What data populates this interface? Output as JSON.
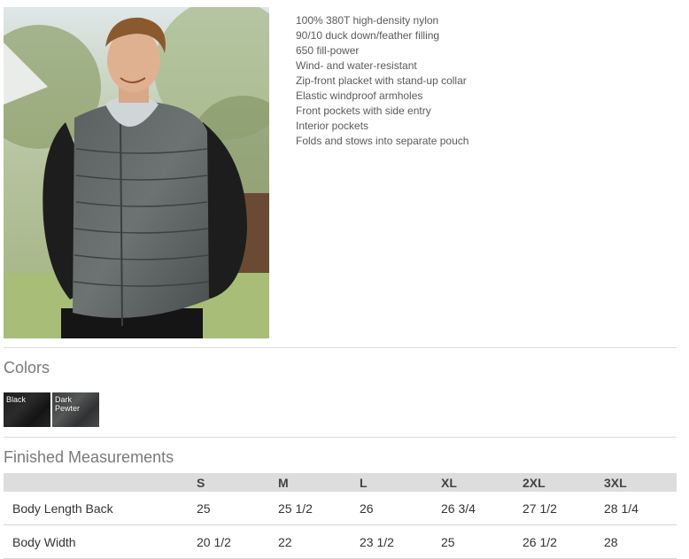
{
  "features": [
    "100% 380T high-density nylon",
    "90/10 duck down/feather filling",
    "650 fill-power",
    "Wind- and water-resistant",
    "Zip-front placket with stand-up collar",
    "Elastic windproof armholes",
    "Front pockets with side entry",
    "Interior pockets",
    "Folds and stows into separate pouch"
  ],
  "colors_section": {
    "title": "Colors",
    "swatches": [
      {
        "label": "Black",
        "hex": "#1e1e1e"
      },
      {
        "label": "Dark Pewter",
        "hex": "#4a4c4c"
      }
    ]
  },
  "measurements": {
    "title": "Finished Measurements",
    "sizes": [
      "S",
      "M",
      "L",
      "XL",
      "2XL",
      "3XL"
    ],
    "rows": [
      {
        "label": "Body Length Back",
        "values": [
          "25",
          "25 1/2",
          "26",
          "26 3/4",
          "27 1/2",
          "28 1/4"
        ]
      },
      {
        "label": "Body Width",
        "values": [
          "20 1/2",
          "22",
          "23 1/2",
          "25",
          "26 1/2",
          "28"
        ]
      }
    ]
  }
}
